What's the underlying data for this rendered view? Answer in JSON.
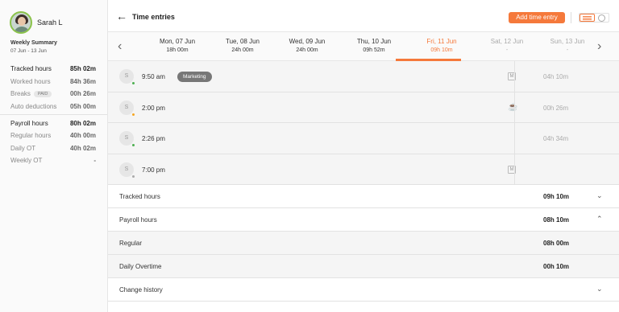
{
  "user": {
    "name": "Sarah L"
  },
  "summary": {
    "title": "Weekly Summary",
    "range": "07 Jun - 13 Jun",
    "stats": [
      {
        "label": "Tracked hours",
        "value": "85h 02m",
        "strong": true
      },
      {
        "label": "Worked hours",
        "value": "84h 36m"
      },
      {
        "label": "Breaks",
        "badge": "PAID",
        "value": "00h 26m"
      },
      {
        "label": "Auto deductions",
        "value": "05h 00m"
      }
    ],
    "stats2": [
      {
        "label": "Payroll hours",
        "value": "80h 02m",
        "strong": true
      },
      {
        "label": "Regular hours",
        "value": "40h 00m"
      },
      {
        "label": "Daily OT",
        "value": "40h 02m"
      },
      {
        "label": "Weekly OT",
        "value": "-"
      }
    ]
  },
  "header": {
    "title": "Time entries",
    "add_button": "Add time entry"
  },
  "days": [
    {
      "name": "Mon, 07 Jun",
      "hours": "18h 00m"
    },
    {
      "name": "Tue, 08 Jun",
      "hours": "24h 00m"
    },
    {
      "name": "Wed, 09 Jun",
      "hours": "24h 00m"
    },
    {
      "name": "Thu, 10 Jun",
      "hours": "09h 52m"
    },
    {
      "name": "Fri, 11 Jun",
      "hours": "09h 10m"
    },
    {
      "name": "Sat, 12 Jun",
      "hours": "-"
    },
    {
      "name": "Sun, 13 Jun",
      "hours": "-"
    }
  ],
  "entries": [
    {
      "initial": "S",
      "time": "9:50 am",
      "tag": "Marketing",
      "icon": "M",
      "duration": "04h 10m",
      "status_color": "#4caf50"
    },
    {
      "initial": "S",
      "time": "2:00 pm",
      "tag": "",
      "icon": "coffee-cup",
      "duration": "00h 26m",
      "status_color": "#f5a623"
    },
    {
      "initial": "S",
      "time": "2:26 pm",
      "tag": "",
      "icon": "",
      "duration": "04h 34m",
      "status_color": "#4caf50"
    },
    {
      "initial": "S",
      "time": "7:00 pm",
      "tag": "",
      "icon": "M",
      "duration": "",
      "status_color": "#aaaaaa"
    }
  ],
  "totals": {
    "tracked": {
      "label": "Tracked hours",
      "value": "09h 10m"
    },
    "payroll": {
      "label": "Payroll hours",
      "value": "08h 10m"
    },
    "regular": {
      "label": "Regular",
      "value": "08h 00m"
    },
    "daily_ot": {
      "label": "Daily Overtime",
      "value": "00h 10m"
    },
    "history": {
      "label": "Change history"
    }
  },
  "colors": {
    "accent": "#f5793b",
    "active_status": "#4caf50",
    "break_status": "#f5a623"
  }
}
